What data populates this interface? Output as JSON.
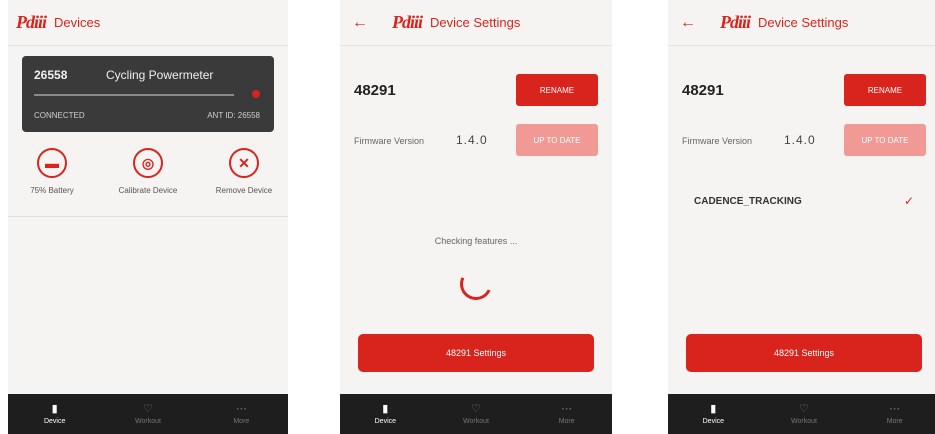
{
  "brand": {
    "logo_text": "Pdiii",
    "accent": "#d9241d"
  },
  "screen1": {
    "title": "Devices",
    "device": {
      "id": "26558",
      "name": "Cycling Powermeter",
      "status": "CONNECTED",
      "protocol": "ANT ID: 26558"
    },
    "actions": [
      {
        "icon": "battery-icon",
        "glyph": "▬",
        "label": "75% Battery"
      },
      {
        "icon": "calibrate-icon",
        "glyph": "◎",
        "label": "Calibrate Device"
      },
      {
        "icon": "remove-icon",
        "glyph": "✕",
        "label": "Remove Device"
      }
    ]
  },
  "screen2": {
    "title": "Device Settings",
    "device_number": "48291",
    "rename_label": "RENAME",
    "firmware_label": "Firmware Version",
    "firmware_value": "1.4.0",
    "update_label": "UP TO DATE",
    "checking_text": "Checking features ...",
    "settings_button": "48291 Settings"
  },
  "screen3": {
    "title": "Device Settings",
    "device_number": "48291",
    "rename_label": "RENAME",
    "firmware_label": "Firmware Version",
    "firmware_value": "1.4.0",
    "update_label": "UP TO DATE",
    "feature_name": "CADENCE_TRACKING",
    "feature_check": "✓",
    "settings_button": "48291 Settings"
  },
  "nav": [
    {
      "icon": "device-icon",
      "glyph": "▮",
      "label": "Device"
    },
    {
      "icon": "workout-icon",
      "glyph": "♡",
      "label": "Workout"
    },
    {
      "icon": "more-icon",
      "glyph": "⋯",
      "label": "More"
    }
  ]
}
